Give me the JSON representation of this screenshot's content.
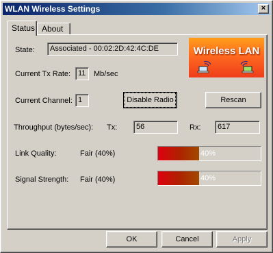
{
  "window": {
    "title": "WLAN Wireless Settings",
    "close_glyph": "×"
  },
  "tabs": [
    {
      "label": "Status"
    },
    {
      "label": "About"
    }
  ],
  "state": {
    "label": "State:",
    "value": "Associated - 00:02:2D:42:4C:DE"
  },
  "tx_rate": {
    "label": "Current Tx Rate:",
    "value": "11",
    "unit": "Mb/sec"
  },
  "channel": {
    "label": "Current Channel:",
    "value": "1"
  },
  "buttons": {
    "disable_radio": "Disable Radio",
    "rescan": "Rescan",
    "ok": "OK",
    "cancel": "Cancel",
    "apply": "Apply"
  },
  "throughput": {
    "label": "Throughput (bytes/sec):",
    "tx_label": "Tx:",
    "tx_value": "56",
    "rx_label": "Rx:",
    "rx_value": "617"
  },
  "link_quality": {
    "label": "Link Quality:",
    "value_text": "Fair (40%)",
    "percent": 40,
    "bar_text": "40%"
  },
  "signal_strength": {
    "label": "Signal Strength:",
    "value_text": "Fair (40%)",
    "percent": 40,
    "bar_text": "40%"
  },
  "banner": {
    "text": "Wireless LAN",
    "icon": "laptop-wireless-icon"
  },
  "colors": {
    "titlebar_start": "#0a246a",
    "bar_fill": "#d00010",
    "banner": "#ff7a1f"
  }
}
